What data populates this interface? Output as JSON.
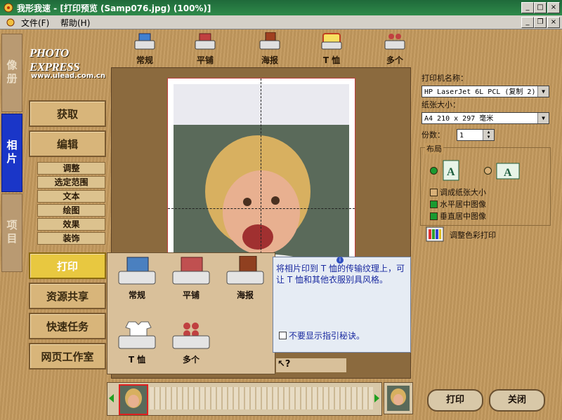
{
  "window": {
    "title": "我形我速 - [打印预览 (Samp076.jpg)  (100%)]"
  },
  "menu": {
    "file": "文件(F)",
    "help": "帮助(H)"
  },
  "brand": {
    "logo": "PHOTO EXPRESS",
    "url": "www.ulead.com.cn"
  },
  "side_tabs": {
    "album": "像册",
    "photo": "相片",
    "project": "项目"
  },
  "nav": {
    "get": "获取",
    "edit": "编辑",
    "sub": [
      "调整",
      "选定范围",
      "文本",
      "绘图",
      "效果",
      "装饰"
    ],
    "print": "打印",
    "share": "资源共享",
    "quick": "快速任务",
    "web": "网页工作室"
  },
  "toolbar": [
    "常规",
    "平铺",
    "海报",
    "T 恤",
    "多个"
  ],
  "right_panel": {
    "printer_label": "打印机名称：",
    "printer_value": "HP LaserJet 6L PCL (复制 2)",
    "paper_label": "纸张大小：",
    "paper_value": "A4 210 x 297 毫米",
    "copies_label": "份数：",
    "copies_value": "1",
    "layout_label": "布局",
    "fit_paper": "调成纸张大小",
    "center_h": "水平居中图像",
    "center_v": "垂直居中图像",
    "color_print": "调整色彩打印",
    "fit_checked": false,
    "center_h_checked": true,
    "center_v_checked": true
  },
  "popup": {
    "items": [
      "常规",
      "平铺",
      "海报",
      "T 恤",
      "多个"
    ],
    "tip": "将相片印到 T 恤的传输纹理上，可让 T 恤和其他衣服别具风格。",
    "dont_show": "不要显示指引秘诀。"
  },
  "buttons": {
    "print": "打印",
    "close": "关闭"
  },
  "colors": {
    "accent_blue": "#1a36c8",
    "title_green": "#2f8a4a",
    "check_green": "#1a9a30"
  }
}
